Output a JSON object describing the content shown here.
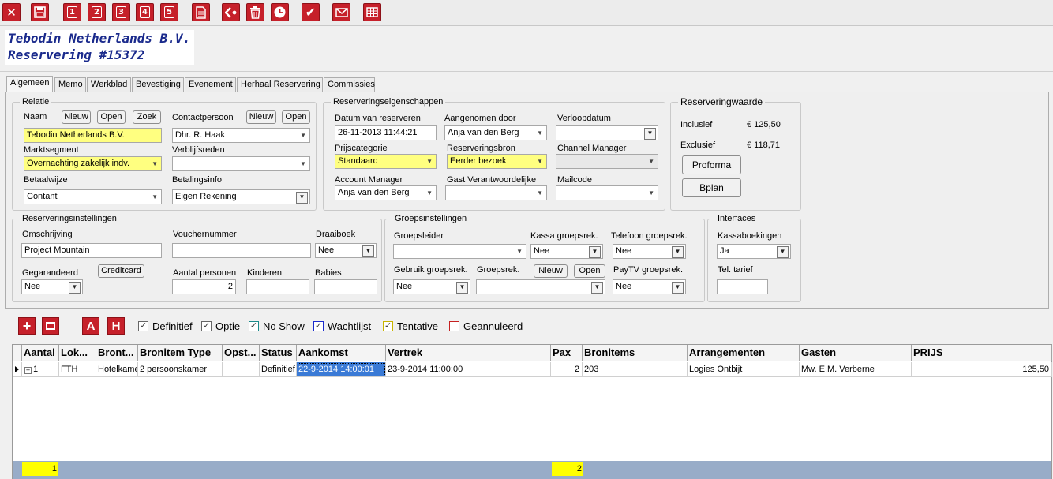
{
  "toolbar": {
    "buttons": [
      {
        "name": "close-icon",
        "glyph": "✕"
      },
      {
        "name": "save-icon",
        "glyph": ""
      },
      {
        "name": "print-1-icon",
        "glyph": "1"
      },
      {
        "name": "print-2-icon",
        "glyph": "2"
      },
      {
        "name": "print-3-icon",
        "glyph": "3"
      },
      {
        "name": "print-4-icon",
        "glyph": "4"
      },
      {
        "name": "print-5-icon",
        "glyph": "5"
      },
      {
        "name": "document-icon",
        "glyph": ""
      },
      {
        "name": "back-icon",
        "glyph": ""
      },
      {
        "name": "trash-icon",
        "glyph": ""
      },
      {
        "name": "clock-icon",
        "glyph": ""
      },
      {
        "name": "check-icon",
        "glyph": "✔"
      },
      {
        "name": "mail-icon",
        "glyph": ""
      },
      {
        "name": "grid-icon",
        "glyph": ""
      }
    ],
    "accent": "#c6202a"
  },
  "header": {
    "company": "Tebodin Netherlands B.V.",
    "reservation": "Reservering #15372"
  },
  "tabs": [
    "Algemeen",
    "Memo",
    "Werkblad",
    "Bevestiging",
    "Evenement",
    "Herhaal Reservering",
    "Commissies"
  ],
  "relatie": {
    "title": "Relatie",
    "naam_label": "Naam",
    "btn_nieuw": "Nieuw",
    "btn_open": "Open",
    "btn_zoek": "Zoek",
    "naam_value": "Tebodin Netherlands B.V.",
    "contact_label": "Contactpersoon",
    "contact_btn_nieuw": "Nieuw",
    "contact_btn_open": "Open",
    "contact_value": "Dhr. R. Haak",
    "marktsegment_label": "Marktsegment",
    "marktsegment_value": "Overnachting zakelijk indv.",
    "verblijfsreden_label": "Verblijfsreden",
    "verblijfsreden_value": "",
    "betaalwijze_label": "Betaalwijze",
    "betaalwijze_value": "Contant",
    "betalingsinfo_label": "Betalingsinfo",
    "betalingsinfo_value": "Eigen Rekening"
  },
  "reserveringseigenschappen": {
    "title": "Reserveringseigenschappen",
    "datum_label": "Datum van reserveren",
    "datum_value": "26-11-2013 11:44:21",
    "aangenomen_label": "Aangenomen door",
    "aangenomen_value": "Anja van den Berg",
    "verloop_label": "Verloopdatum",
    "verloop_value": "",
    "prijscat_label": "Prijscategorie",
    "prijscat_value": "Standaard",
    "bron_label": "Reserveringsbron",
    "bron_value": "Eerder bezoek",
    "channel_label": "Channel Manager",
    "channel_value": "",
    "account_label": "Account Manager",
    "account_value": "Anja van den Berg",
    "gast_label": "Gast Verantwoordelijke",
    "gast_value": "",
    "mailcode_label": "Mailcode",
    "mailcode_value": ""
  },
  "reserveringwaarde": {
    "title": "Reserveringwaarde",
    "inclusief_label": "Inclusief",
    "inclusief_value": "€ 125,50",
    "exclusief_label": "Exclusief",
    "exclusief_value": "€ 118,71",
    "btn_proforma": "Proforma",
    "btn_bplan": "Bplan"
  },
  "reserveringsinstellingen": {
    "title": "Reserveringsinstellingen",
    "omschrijving_label": "Omschrijving",
    "omschrijving_value": "Project Mountain",
    "voucher_label": "Vouchernummer",
    "voucher_value": "",
    "draaiboek_label": "Draaiboek",
    "draaiboek_value": "Nee",
    "gegarandeerd_label": "Gegarandeerd",
    "gegarandeerd_value": "Nee",
    "btn_creditcard": "Creditcard",
    "personen_label": "Aantal personen",
    "personen_value": "2",
    "kinderen_label": "Kinderen",
    "kinderen_value": "",
    "babies_label": "Babies",
    "babies_value": ""
  },
  "groepsinstellingen": {
    "title": "Groepsinstellingen",
    "groepsleider_label": "Groepsleider",
    "groepsleider_value": "",
    "kassa_label": "Kassa groepsrek.",
    "kassa_value": "Nee",
    "telefoon_label": "Telefoon groepsrek.",
    "telefoon_value": "Nee",
    "gebruik_label": "Gebruik groepsrek.",
    "gebruik_value": "Nee",
    "groepsrek_label": "Groepsrek.",
    "groepsrek_value": "",
    "btn_nieuw": "Nieuw",
    "btn_open": "Open",
    "paytv_label": "PayTV groepsrek.",
    "paytv_value": "Nee"
  },
  "interfaces": {
    "title": "Interfaces",
    "kassa_label": "Kassaboekingen",
    "kassa_value": "Ja",
    "tel_label": "Tel. tarief",
    "tel_value": ""
  },
  "listbar": {
    "btn_add": "+",
    "btn_remove": "−",
    "btn_a": "A",
    "btn_h": "H",
    "filters": [
      {
        "label": "Definitief",
        "checked": true,
        "color": "#666666"
      },
      {
        "label": "Optie",
        "checked": true,
        "color": "#666666"
      },
      {
        "label": "No Show",
        "checked": true,
        "color": "#1a8a8a"
      },
      {
        "label": "Wachtlijst",
        "checked": true,
        "color": "#1a2acc"
      },
      {
        "label": "Tentative",
        "checked": true,
        "color": "#c8b400"
      },
      {
        "label": "Geannuleerd",
        "checked": false,
        "color": "#c62020"
      }
    ]
  },
  "grid": {
    "columns": [
      "Aantal",
      "Lok...",
      "Bront...",
      "Bronitem Type",
      "Opst...",
      "Status",
      "Aankomst",
      "Vertrek",
      "Pax",
      "Bronitems",
      "Arrangementen",
      "Gasten",
      "PRIJS"
    ],
    "rows": [
      [
        "1",
        "FTH",
        "Hotelkamer",
        "2 persoonskamer",
        "",
        "Definitief",
        "22-9-2014 14:00:01",
        "23-9-2014 11:00:00",
        "2",
        "203",
        "Logies Ontbijt",
        "Mw. E.M. Verberne",
        "125,50"
      ]
    ],
    "footer_aantal": "1",
    "footer_pax": "2"
  }
}
